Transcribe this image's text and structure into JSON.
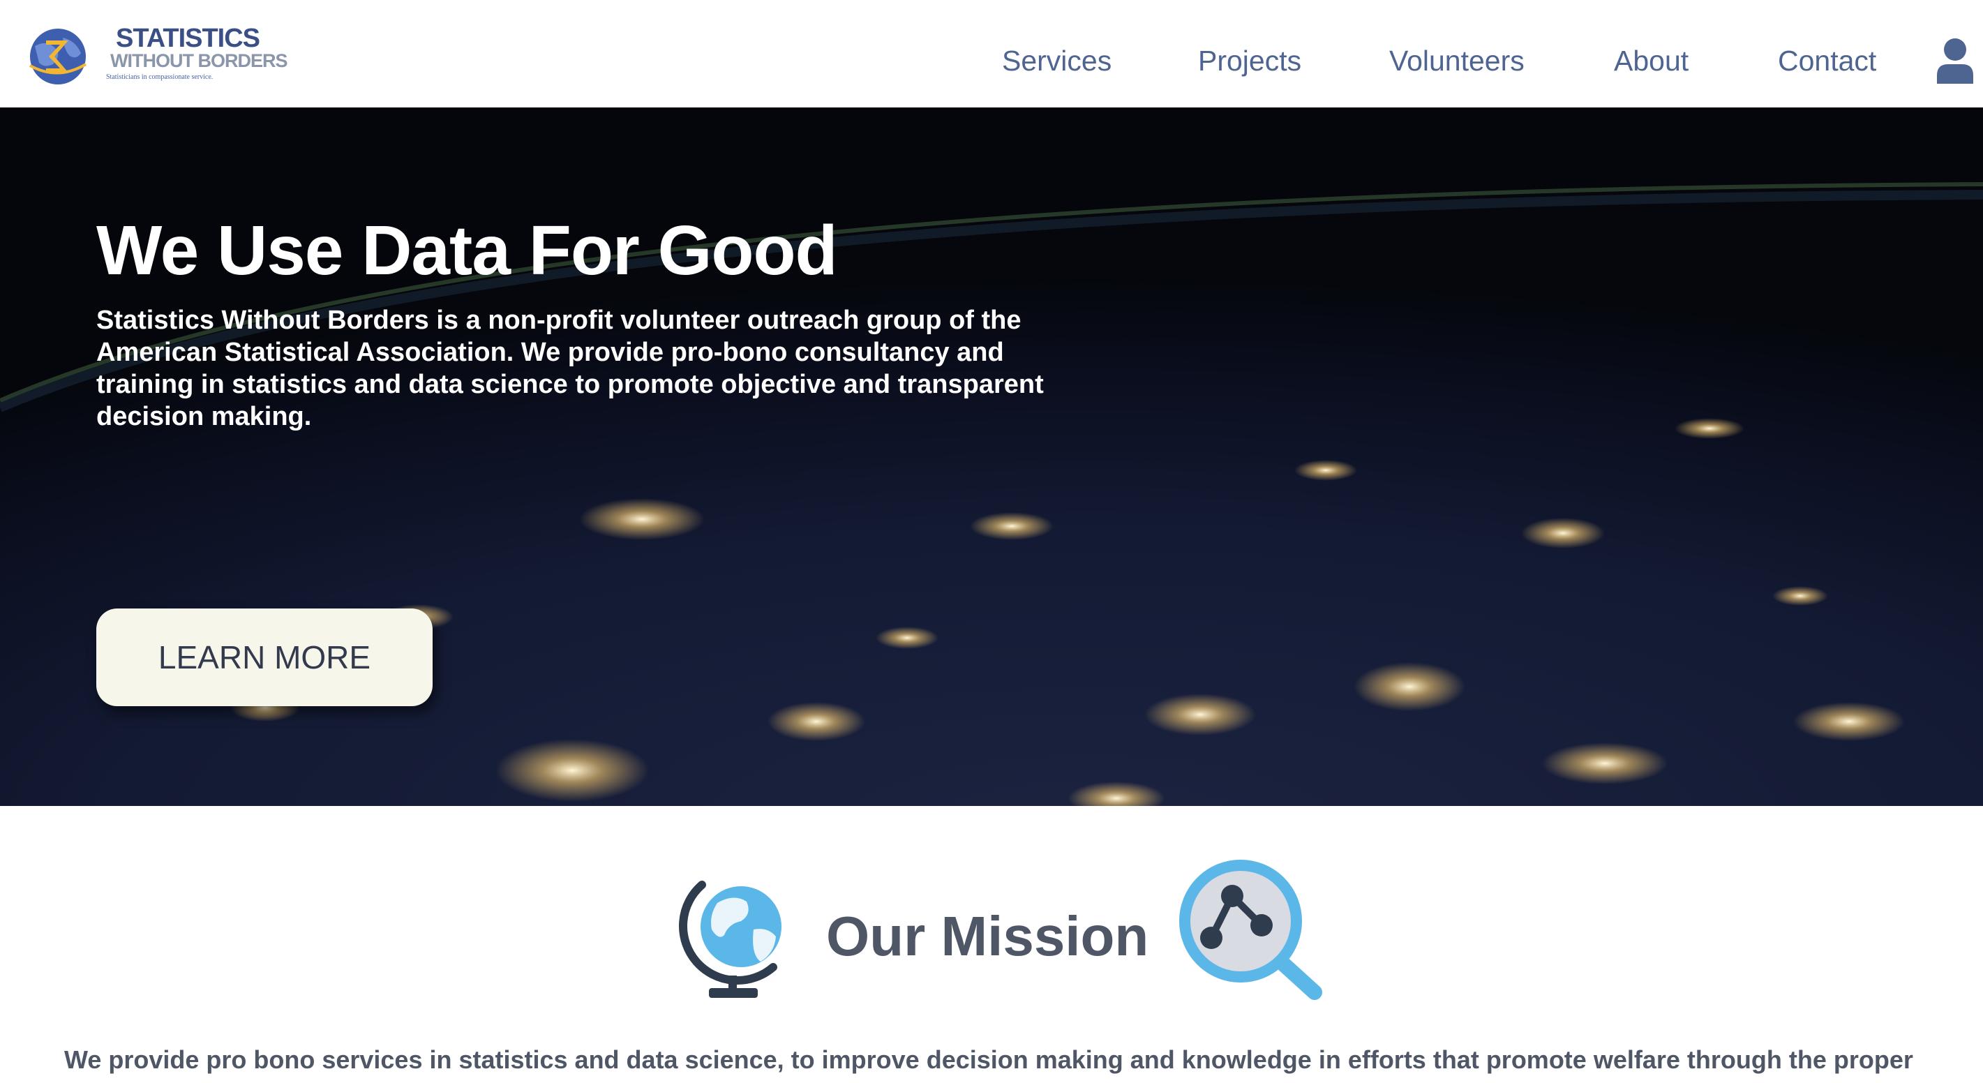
{
  "header": {
    "logo": {
      "title": "STATISTICS",
      "subtitle": "WITHOUT BORDERS",
      "tagline": "Statisticians in compassionate service."
    },
    "nav": [
      {
        "label": "Services"
      },
      {
        "label": "Projects"
      },
      {
        "label": "Volunteers"
      },
      {
        "label": "About"
      },
      {
        "label": "Contact"
      }
    ],
    "user_icon": "user-icon"
  },
  "hero": {
    "title": "We Use Data For Good",
    "description": "Statistics Without Borders is a non-profit volunteer outreach group of the American Statistical Association. We provide pro-bono consultancy and training in statistics and data science to promote objective and transparent decision making.",
    "button_label": "LEARN MORE"
  },
  "mission": {
    "title": "Our Mission",
    "left_icon": "globe-icon",
    "right_icon": "network-search-icon",
    "text": "We provide pro bono services in statistics and data science, to improve decision making and knowledge in efforts that promote welfare through the proper"
  },
  "colors": {
    "nav": "#4e6592",
    "button_bg": "#f7f6ea",
    "heading": "#4f5767",
    "icon_blue": "#5bb7e8",
    "icon_dark": "#2f3c4d"
  }
}
